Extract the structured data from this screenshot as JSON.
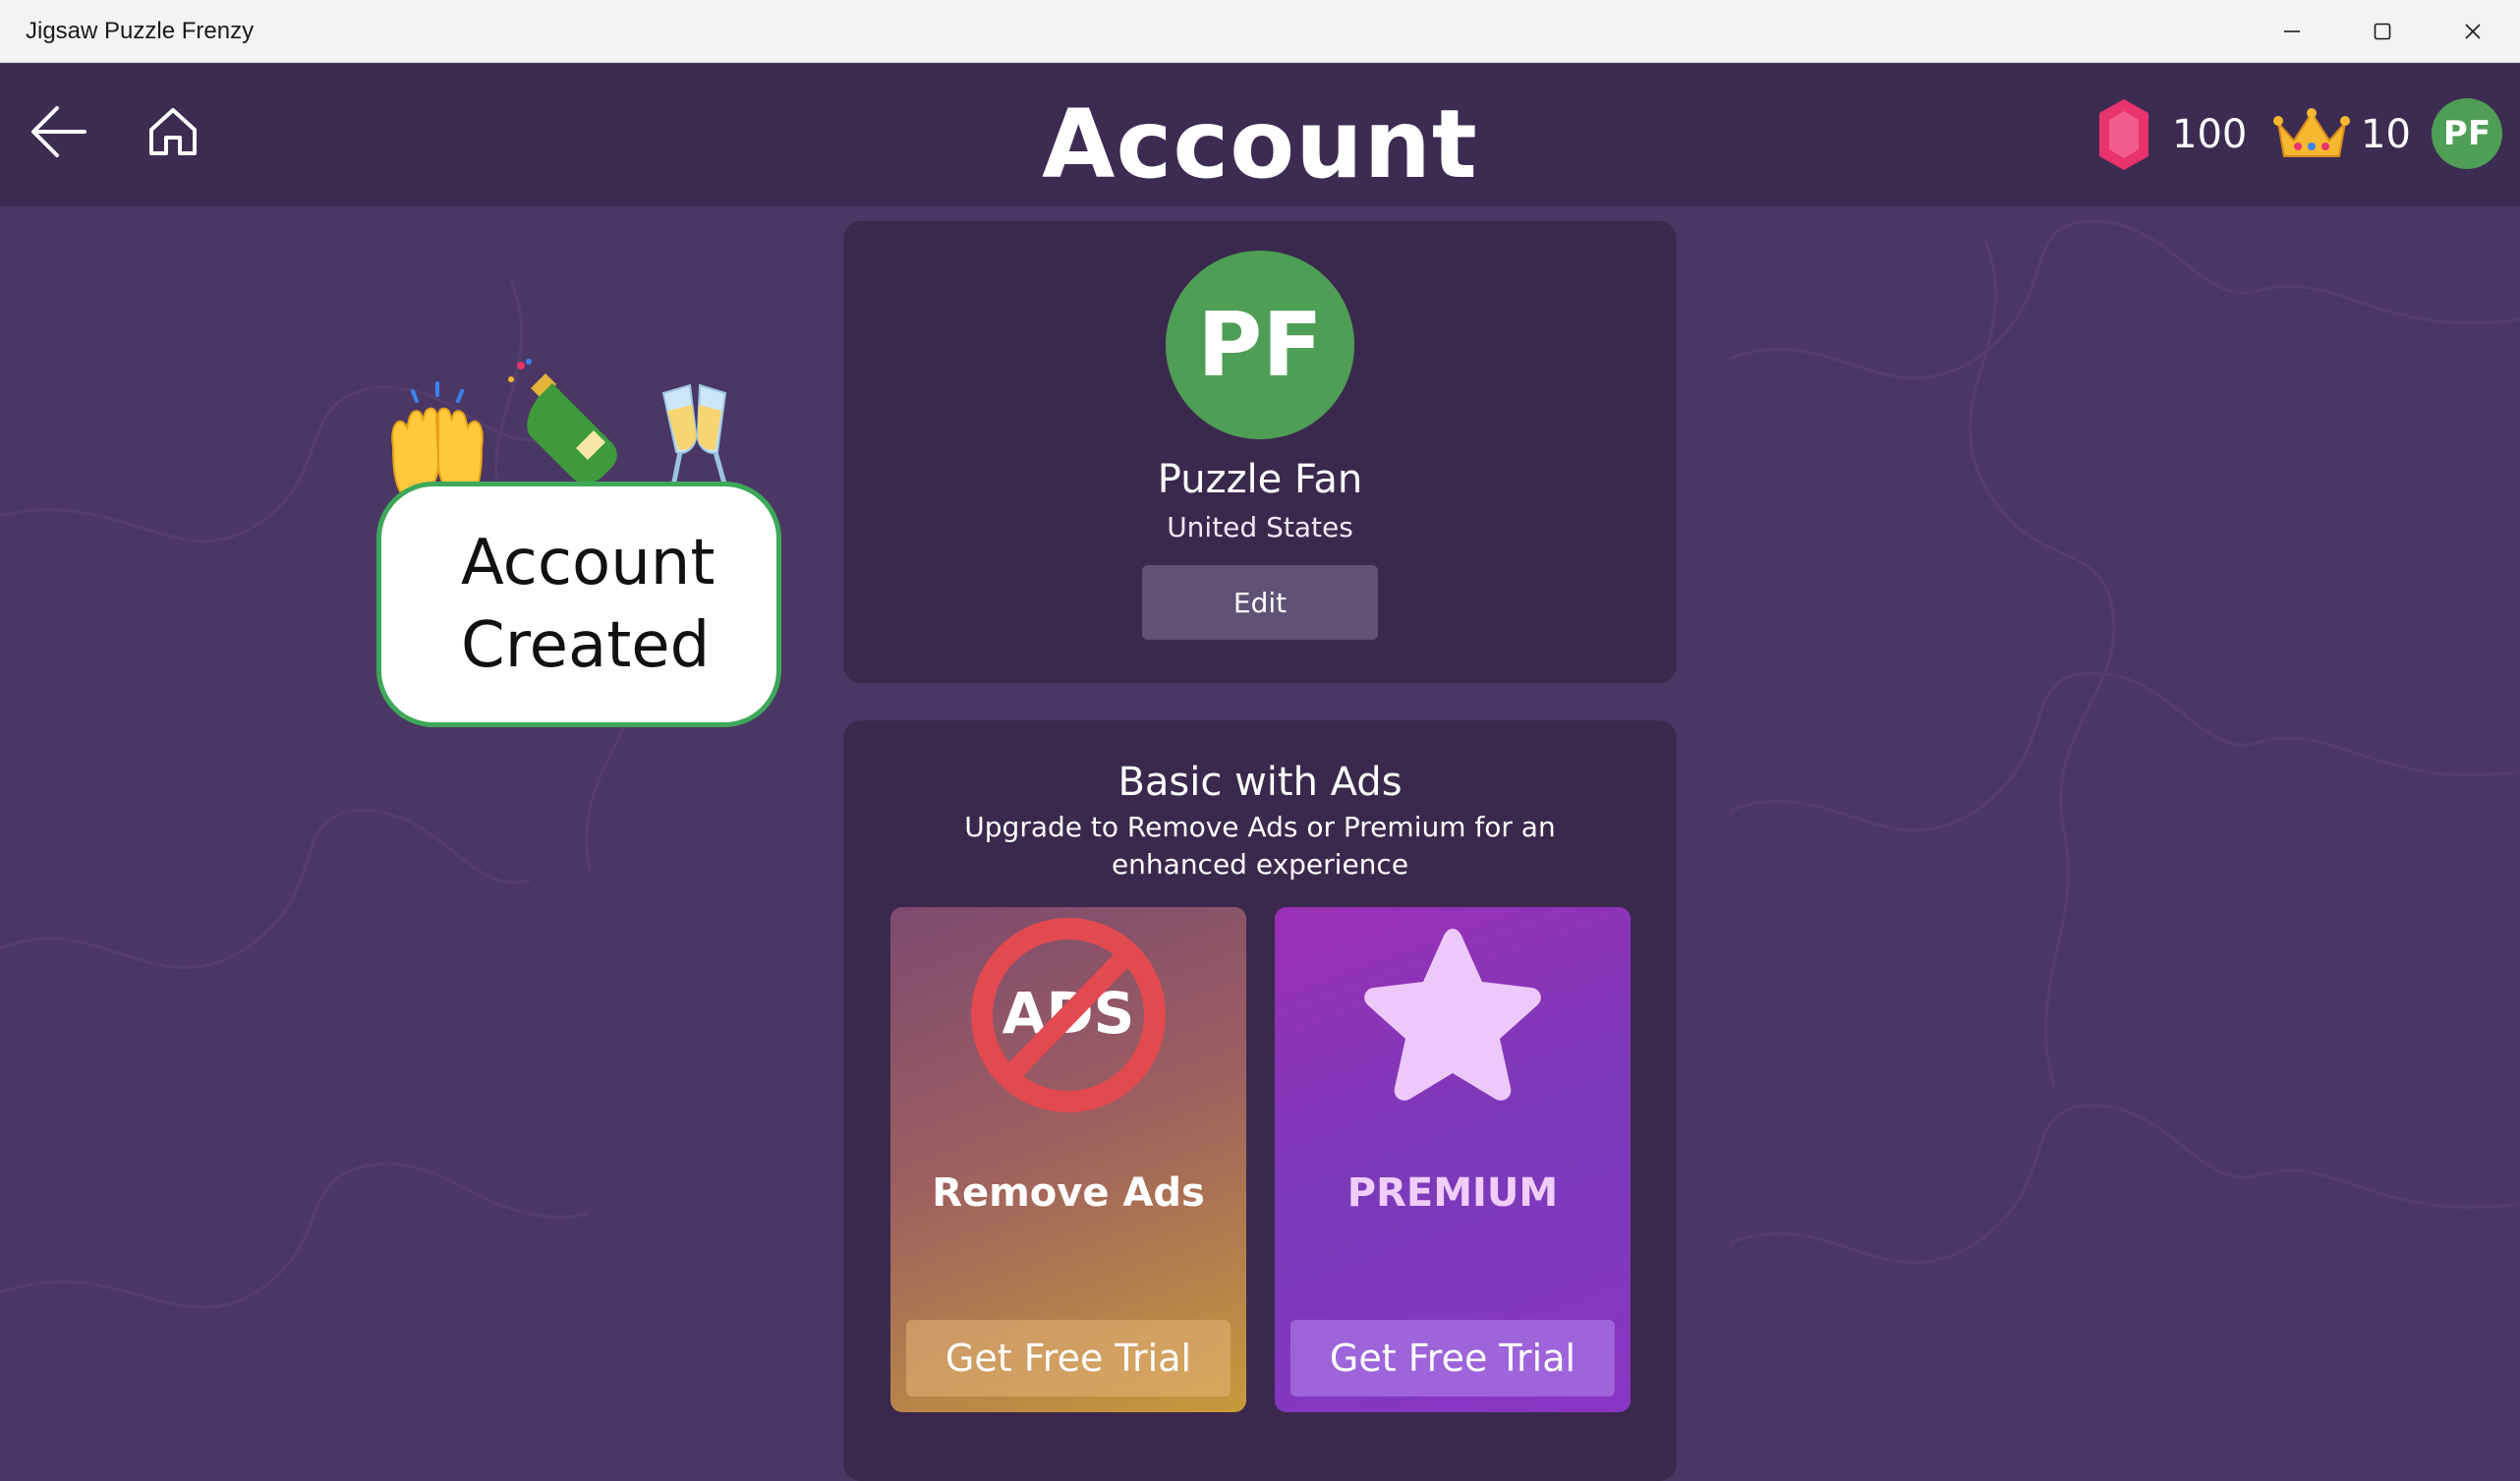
{
  "window": {
    "title": "Jigsaw Puzzle Frenzy",
    "controls": [
      "minimize",
      "maximize",
      "close"
    ]
  },
  "header": {
    "title": "Account",
    "gems": "100",
    "crowns": "10",
    "avatar_initials": "PF"
  },
  "celebration": {
    "emojis": [
      "raising-hands",
      "champagne-bottle",
      "clinking-glasses"
    ],
    "message": "Account Created"
  },
  "profile": {
    "initials": "PF",
    "name": "Puzzle Fan",
    "country": "United States",
    "edit_label": "Edit"
  },
  "subscription": {
    "title": "Basic with Ads",
    "description": "Upgrade to Remove Ads or Premium for an enhanced experience",
    "tiles": [
      {
        "label": "Remove Ads",
        "icon_text": "ADS",
        "button": "Get Free Trial"
      },
      {
        "label": "PREMIUM",
        "button": "Get Free Trial"
      }
    ]
  },
  "colors": {
    "app_background": "#4b3763",
    "topbar": "#3d2c52",
    "avatar_green": "#4f9e55",
    "gem_pink": "#e8336d",
    "crown_gold": "#f5b82e",
    "speech_border": "#3ea85a"
  }
}
